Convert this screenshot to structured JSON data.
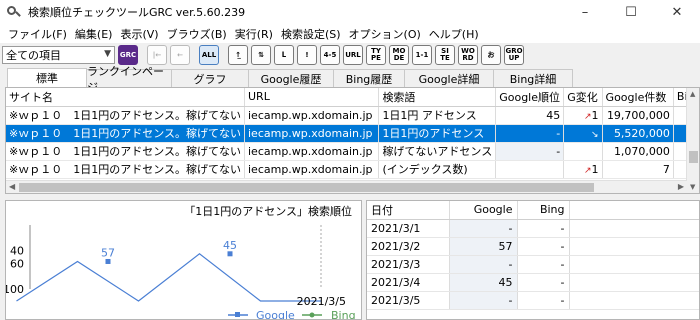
{
  "window": {
    "title": "検索順位チェックツールGRC  ver.5.60.239",
    "controls": [
      "–",
      "☐",
      "✕"
    ]
  },
  "menu": [
    "ファイル(F)",
    "編集(E)",
    "表示(V)",
    "ブラウズ(B)",
    "実行(R)",
    "検索設定(S)",
    "オプション(O)",
    "ヘルプ(H)"
  ],
  "toolbar": {
    "filter_value": "全ての項目",
    "grc": "GRC",
    "back": "|←",
    "prev": "←",
    "all": "ALL",
    "b_up": "↑̲",
    "b_sort": "⇅",
    "b_down": "ᒪ",
    "b_excl": "!",
    "b_45": "4-5",
    "b_url": "URL",
    "b_type": "TY PE",
    "b_mode": "MO DE",
    "b_11": "1-1",
    "b_site": "SI TE",
    "b_word": "WO RD",
    "b_o": "お",
    "b_group": "GRO UP"
  },
  "tabs": [
    "標準",
    "ランクインページ",
    "グラフ",
    "Google履歴",
    "Bing履歴",
    "Google詳細",
    "Bing詳細"
  ],
  "grid": {
    "headers": [
      "サイト名",
      "URL",
      "検索語",
      "Google順位",
      "G変化",
      "Google件数",
      "Bin"
    ],
    "rows": [
      {
        "site": "※ｗｐ１０　1日1円のアドセンス。稼げてない",
        "url": "iecamp.wp.xdomain.jp",
        "keyword": "1日1円 アドセンス",
        "rank": "45",
        "change": "1",
        "change_dir": "↗",
        "count": "19,700,000",
        "bing": ""
      },
      {
        "site": "※ｗｐ１０　1日1円のアドセンス。稼げてない",
        "url": "iecamp.wp.xdomain.jp",
        "keyword": "1日1円のアドセンス",
        "rank": "-",
        "change": "",
        "change_dir": "↘",
        "count": "5,520,000",
        "bing": ""
      },
      {
        "site": "※ｗｐ１０　1日1円のアドセンス。稼げてない",
        "url": "iecamp.wp.xdomain.jp",
        "keyword": "稼げてないアドセンス",
        "rank": "-",
        "change": "",
        "change_dir": "",
        "count": "1,070,000",
        "bing": ""
      },
      {
        "site": "※ｗｐ１０　1日1円のアドセンス。稼げてない",
        "url": "iecamp.wp.xdomain.jp",
        "keyword": "(インデックス数)",
        "rank": "",
        "change": "1",
        "change_dir": "↗",
        "count": "7",
        "bing": ""
      }
    ]
  },
  "chart_data": {
    "type": "line",
    "title": "「1日1円のアドセンス」検索順位",
    "y_ticks": [
      "40",
      "60",
      "100"
    ],
    "ylim": [
      0,
      100
    ],
    "y_inverted": true,
    "x_last_label": "2021/3/5",
    "x": [
      "2021/3/1",
      "2021/3/2",
      "2021/3/3",
      "2021/3/4",
      "2021/3/5"
    ],
    "series": [
      {
        "name": "Google",
        "values": [
          null,
          57,
          null,
          45,
          null
        ],
        "color": "#4a7fd4"
      },
      {
        "name": "Bing",
        "values": [
          null,
          null,
          null,
          null,
          null
        ],
        "color": "#5aa05a"
      }
    ],
    "data_labels": [
      "57",
      "45"
    ]
  },
  "history": {
    "headers": [
      "日付",
      "Google",
      "Bing"
    ],
    "rows": [
      {
        "date": "2021/3/1",
        "google": "-",
        "bing": "-"
      },
      {
        "date": "2021/3/2",
        "google": "57",
        "bing": "-"
      },
      {
        "date": "2021/3/3",
        "google": "-",
        "bing": "-"
      },
      {
        "date": "2021/3/4",
        "google": "45",
        "bing": "-"
      },
      {
        "date": "2021/3/5",
        "google": "-",
        "bing": "-"
      }
    ]
  }
}
